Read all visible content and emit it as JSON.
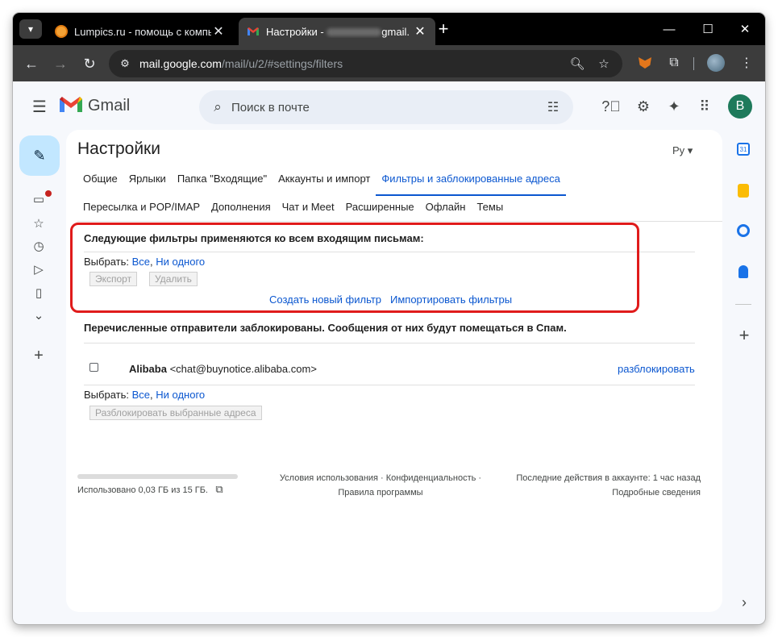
{
  "browser": {
    "tabs": [
      {
        "title": "Lumpics.ru - помощь с компьк",
        "active": false
      },
      {
        "title_prefix": "Настройки - ",
        "title_suffix": "gmail.",
        "active": true
      }
    ],
    "url_host": "mail.google.com",
    "url_path": "/mail/u/2/#settings/filters"
  },
  "gmail": {
    "brand": "Gmail",
    "search_placeholder": "Поиск в почте",
    "account_initial": "B"
  },
  "settings": {
    "title": "Настройки",
    "language_badge": "Ру",
    "tabs_row1": [
      "Общие",
      "Ярлыки",
      "Папка \"Входящие\"",
      "Аккаунты и импорт",
      "Фильтры и заблокированные адреса"
    ],
    "tabs_row2": [
      "Пересылка и POP/IMAP",
      "Дополнения",
      "Чат и Meet",
      "Расширенные",
      "Офлайн",
      "Темы"
    ],
    "active_tab": "Фильтры и заблокированные адреса",
    "filters_section": {
      "heading": "Следующие фильтры применяются ко всем входящим письмам:",
      "select_label": "Выбрать:",
      "select_all": "Все",
      "select_none": "Ни одного",
      "export_button": "Экспорт",
      "delete_button": "Удалить",
      "create_filter_link": "Создать новый фильтр",
      "import_filters_link": "Импортировать фильтры"
    },
    "blocked_section": {
      "heading": "Перечисленные отправители заблокированы. Сообщения от них будут помещаться в Спам.",
      "senders": [
        {
          "name": "Alibaba",
          "email": "<chat@buynotice.alibaba.com>",
          "action": "разблокировать"
        }
      ],
      "select_label": "Выбрать:",
      "select_all": "Все",
      "select_none": "Ни одного",
      "unblock_selected_button": "Разблокировать выбранные адреса"
    }
  },
  "footer": {
    "storage": "Использовано 0,03 ГБ из 15 ГБ.",
    "terms": "Условия использования · Конфиденциальность ·",
    "policies": "Правила программы",
    "last_activity": "Последние действия в аккаунте: 1 час назад",
    "details": "Подробные сведения"
  },
  "colors": {
    "accent": "#0b57d0",
    "highlight_box": "#e01b1b",
    "compose_bg": "#c2e7ff"
  }
}
